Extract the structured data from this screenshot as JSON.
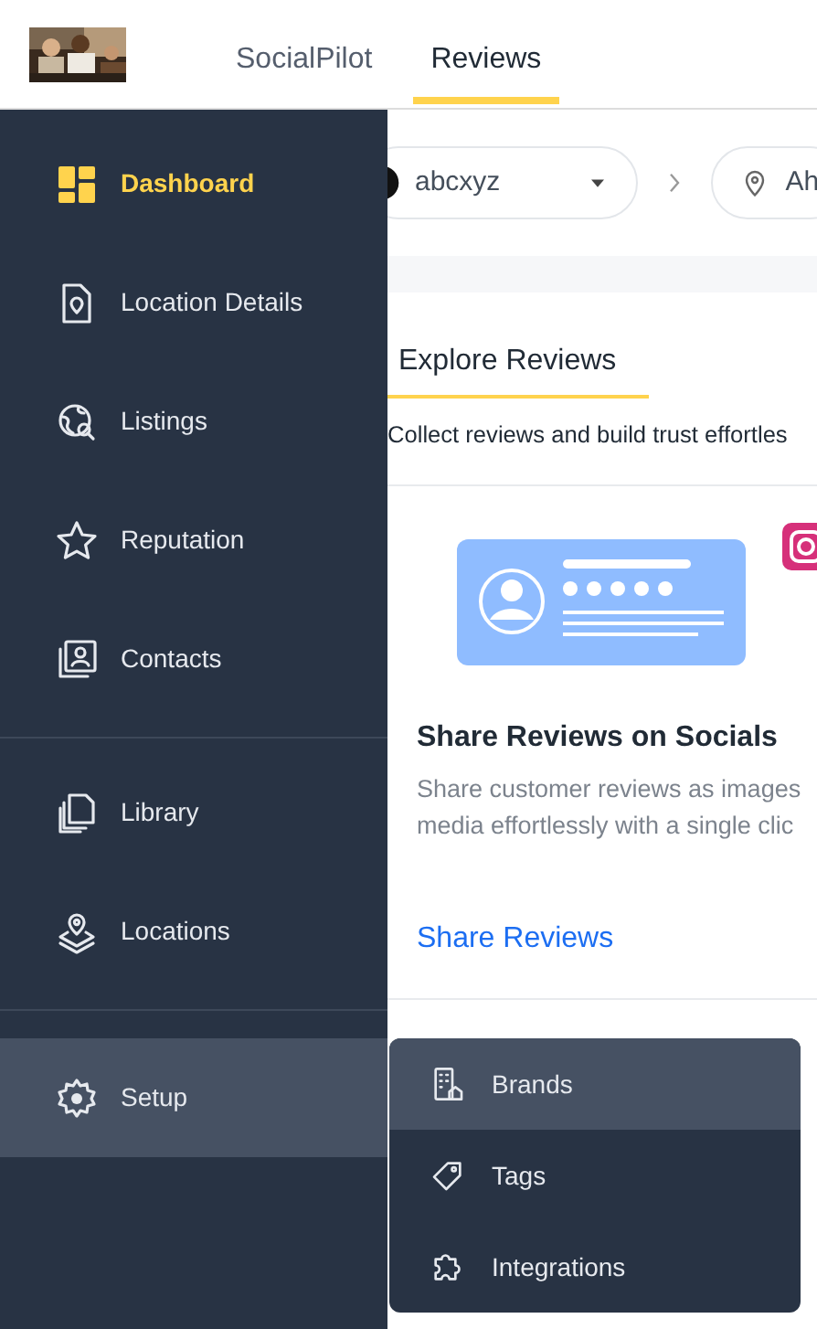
{
  "header": {
    "tabs": [
      {
        "label": "SocialPilot",
        "selected": false
      },
      {
        "label": "Reviews",
        "selected": true
      }
    ]
  },
  "sidebar": {
    "groups": [
      [
        {
          "label": "Dashboard",
          "selected": true,
          "expanded": false
        },
        {
          "label": "Location Details",
          "selected": false,
          "expanded": false
        },
        {
          "label": "Listings",
          "selected": false,
          "expanded": false
        },
        {
          "label": "Reputation",
          "selected": false,
          "expanded": false
        },
        {
          "label": "Contacts",
          "selected": false,
          "expanded": false
        }
      ],
      [
        {
          "label": "Library",
          "selected": false,
          "expanded": false
        },
        {
          "label": "Locations",
          "selected": false,
          "expanded": false
        }
      ],
      [
        {
          "label": "Setup",
          "selected": false,
          "expanded": true
        }
      ]
    ]
  },
  "submenu": [
    {
      "label": "Brands",
      "highlighted": true
    },
    {
      "label": "Tags",
      "highlighted": false
    },
    {
      "label": "Integrations",
      "highlighted": false
    }
  ],
  "breadcrumb": [
    {
      "kind": "brand",
      "label": "abcxyz"
    },
    {
      "kind": "location",
      "label": "Ah"
    }
  ],
  "card": {
    "tabs": [
      {
        "label": "Explore Reviews",
        "selected": true
      }
    ],
    "subtitle": "Collect reviews and build trust effortles",
    "feature": {
      "title": "Share Reviews on Socials",
      "description": [
        "Share customer reviews as images",
        "media effortlessly with a single clic"
      ],
      "link": "Share Reviews"
    }
  }
}
